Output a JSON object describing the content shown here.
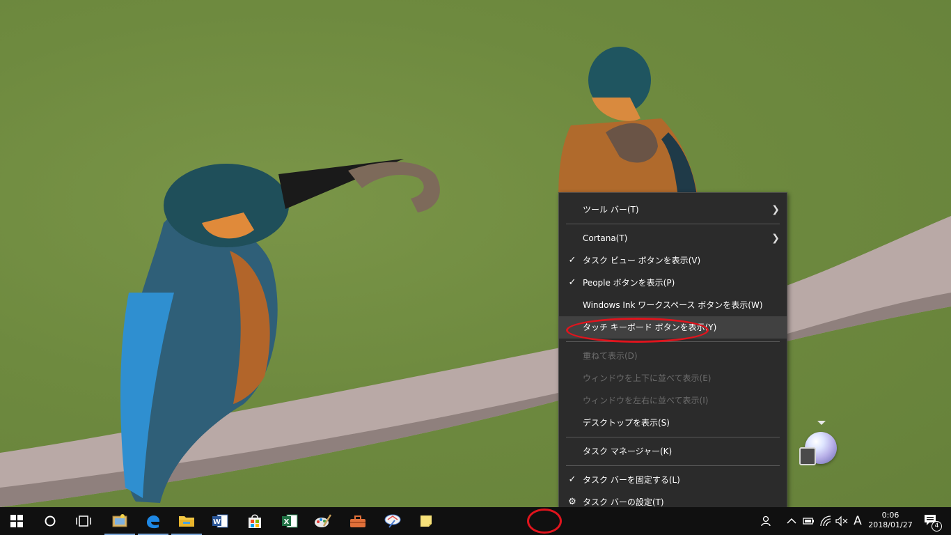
{
  "context_menu": {
    "items": [
      {
        "label": "ツール バー(T)",
        "submenu": true
      },
      {
        "label": "Cortana(T)",
        "submenu": true
      },
      {
        "label": "タスク ビュー ボタンを表示(V)",
        "checked": true
      },
      {
        "label": "People ボタンを表示(P)",
        "checked": true
      },
      {
        "label": "Windows Ink ワークスペース ボタンを表示(W)"
      },
      {
        "label": "タッチ キーボード ボタンを表示(Y)",
        "highlighted": true
      },
      {
        "label": "重ねて表示(D)",
        "disabled": true
      },
      {
        "label": "ウィンドウを上下に並べて表示(E)",
        "disabled": true
      },
      {
        "label": "ウィンドウを左右に並べて表示(I)",
        "disabled": true
      },
      {
        "label": "デスクトップを表示(S)"
      },
      {
        "label": "タスク マネージャー(K)"
      },
      {
        "label": "タスク バーを固定する(L)",
        "checked": true
      },
      {
        "label": "タスク バーの設定(T)",
        "icon": "gear-icon"
      }
    ]
  },
  "taskbar": {
    "pinned_icons": [
      "windows-start-icon",
      "cortana-icon",
      "task-view-icon",
      "photo-viewer-icon",
      "edge-icon",
      "file-explorer-icon",
      "word-icon",
      "store-icon",
      "excel-icon",
      "paint-icon",
      "toolbox-icon",
      "pen-app-icon",
      "sticky-notes-icon"
    ],
    "tray_icons": [
      "people-icon",
      "chevron-up-icon",
      "battery-icon",
      "wifi-icon",
      "volume-muted-icon"
    ],
    "ime_label": "A",
    "time": "0:06",
    "date": "2018/01/27",
    "notification_count": "4"
  },
  "colors": {
    "highlight_red": "#e0141d",
    "menu_bg": "#2b2b2b",
    "taskbar_bg": "#101010"
  }
}
